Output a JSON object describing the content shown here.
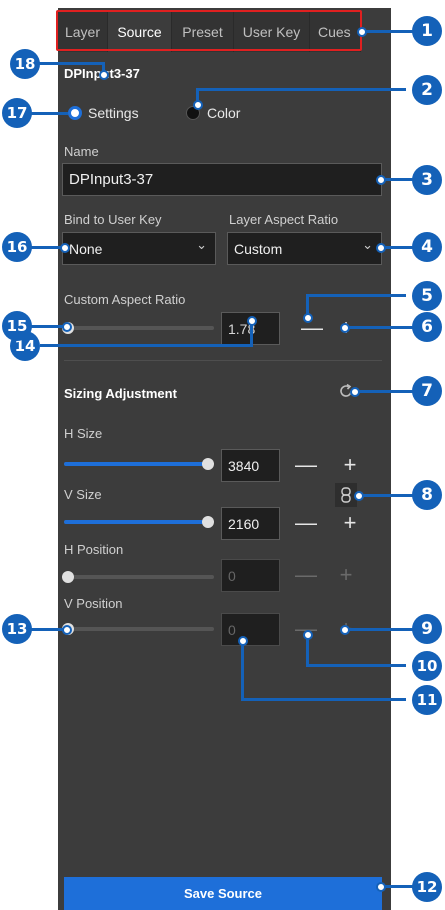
{
  "tabs": [
    "Layer",
    "Source",
    "Preset",
    "User Key",
    "Cues"
  ],
  "active_tab": "Source",
  "source_name_heading": "DPInput3-37",
  "radio": {
    "settings": "Settings",
    "color": "Color",
    "selected": "Settings"
  },
  "name": {
    "label": "Name",
    "value": "DPInput3-37"
  },
  "bind_user_key": {
    "label": "Bind to User Key",
    "value": "None"
  },
  "layer_aspect": {
    "label": "Layer Aspect Ratio",
    "value": "Custom"
  },
  "custom_aspect": {
    "label": "Custom Aspect Ratio",
    "value": "1.78",
    "slider_fraction": 0.0
  },
  "sizing": {
    "title": "Sizing Adjustment",
    "h_size": {
      "label": "H Size",
      "value": "3840",
      "slider_fraction": 1.0
    },
    "v_size": {
      "label": "V Size",
      "value": "2160",
      "slider_fraction": 1.0
    },
    "h_position": {
      "label": "H Position",
      "value": "0",
      "slider_fraction": 0.0
    },
    "v_position": {
      "label": "V Position",
      "value": "0",
      "slider_fraction": 0.0
    }
  },
  "buttons": {
    "minus": "—",
    "plus": "+",
    "save": "Save Source",
    "dropdown": "⌄"
  },
  "callouts": [
    "1",
    "2",
    "3",
    "4",
    "5",
    "6",
    "7",
    "8",
    "9",
    "10",
    "11",
    "12",
    "13",
    "14",
    "15",
    "16",
    "17",
    "18"
  ],
  "colors": {
    "accent": "#1e6fd9",
    "callout": "#1461b8",
    "panel": "#3c3c3c",
    "highlight": "#e02020"
  }
}
